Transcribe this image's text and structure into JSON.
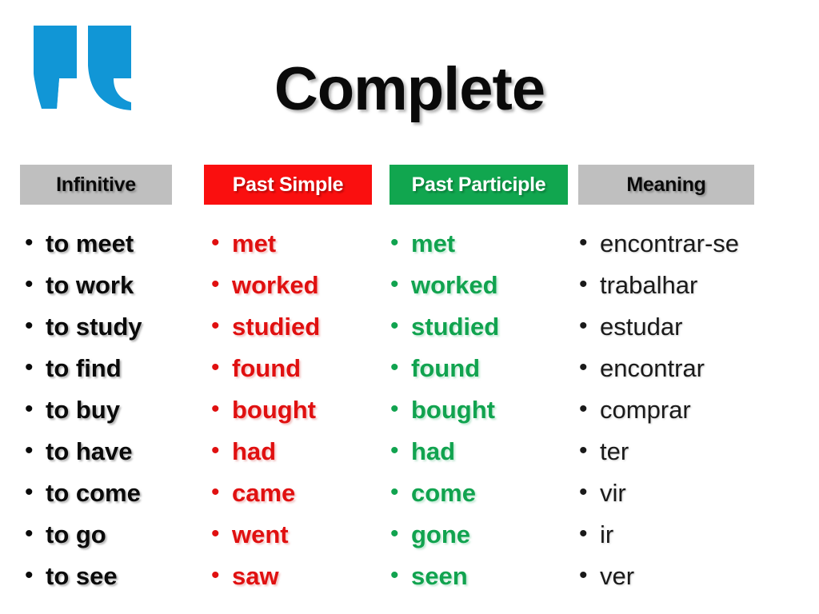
{
  "title": "Complete",
  "logo": {
    "name": "quotation-mark-icon",
    "color": "#1196D6"
  },
  "colors": {
    "header_gray": "#BFBFBF",
    "header_red": "#FA0F0F",
    "header_green": "#11A64F",
    "text_black": "#0A0A0A",
    "text_red": "#E01010",
    "text_green": "#11A34F"
  },
  "headers": [
    {
      "label": "Infinitive",
      "style": "gray"
    },
    {
      "label": "Past Simple",
      "style": "red"
    },
    {
      "label": "Past Participle",
      "style": "green"
    },
    {
      "label": "Meaning",
      "style": "gray"
    }
  ],
  "bullet": "•",
  "columns": {
    "infinitive": [
      "to meet",
      "to work",
      "to study",
      "to find",
      "to buy",
      "to have",
      "to come",
      "to go",
      "to see"
    ],
    "past_simple": [
      "met",
      "worked",
      "studied",
      "found",
      "bought",
      "had",
      "came",
      "went",
      "saw"
    ],
    "past_participle": [
      "met",
      "worked",
      "studied",
      "found",
      "bought",
      "had",
      "come",
      "gone",
      "seen"
    ],
    "meaning": [
      "encontrar-se",
      "trabalhar",
      "estudar",
      "encontrar",
      "comprar",
      "ter",
      "vir",
      "ir",
      "ver"
    ]
  },
  "rows": [
    {
      "infinitive": "to meet",
      "past_simple": "met",
      "past_participle": "met",
      "meaning": "encontrar-se"
    },
    {
      "infinitive": "to work",
      "past_simple": "worked",
      "past_participle": "worked",
      "meaning": "trabalhar"
    },
    {
      "infinitive": "to study",
      "past_simple": "studied",
      "past_participle": "studied",
      "meaning": "estudar"
    },
    {
      "infinitive": "to find",
      "past_simple": "found",
      "past_participle": "found",
      "meaning": "encontrar"
    },
    {
      "infinitive": "to buy",
      "past_simple": "bought",
      "past_participle": "bought",
      "meaning": "comprar"
    },
    {
      "infinitive": "to have",
      "past_simple": "had",
      "past_participle": "had",
      "meaning": "ter"
    },
    {
      "infinitive": "to come",
      "past_simple": "came",
      "past_participle": "come",
      "meaning": "vir"
    },
    {
      "infinitive": "to go",
      "past_simple": "went",
      "past_participle": "gone",
      "meaning": "ir"
    },
    {
      "infinitive": "to see",
      "past_simple": "saw",
      "past_participle": "seen",
      "meaning": "ver"
    }
  ]
}
